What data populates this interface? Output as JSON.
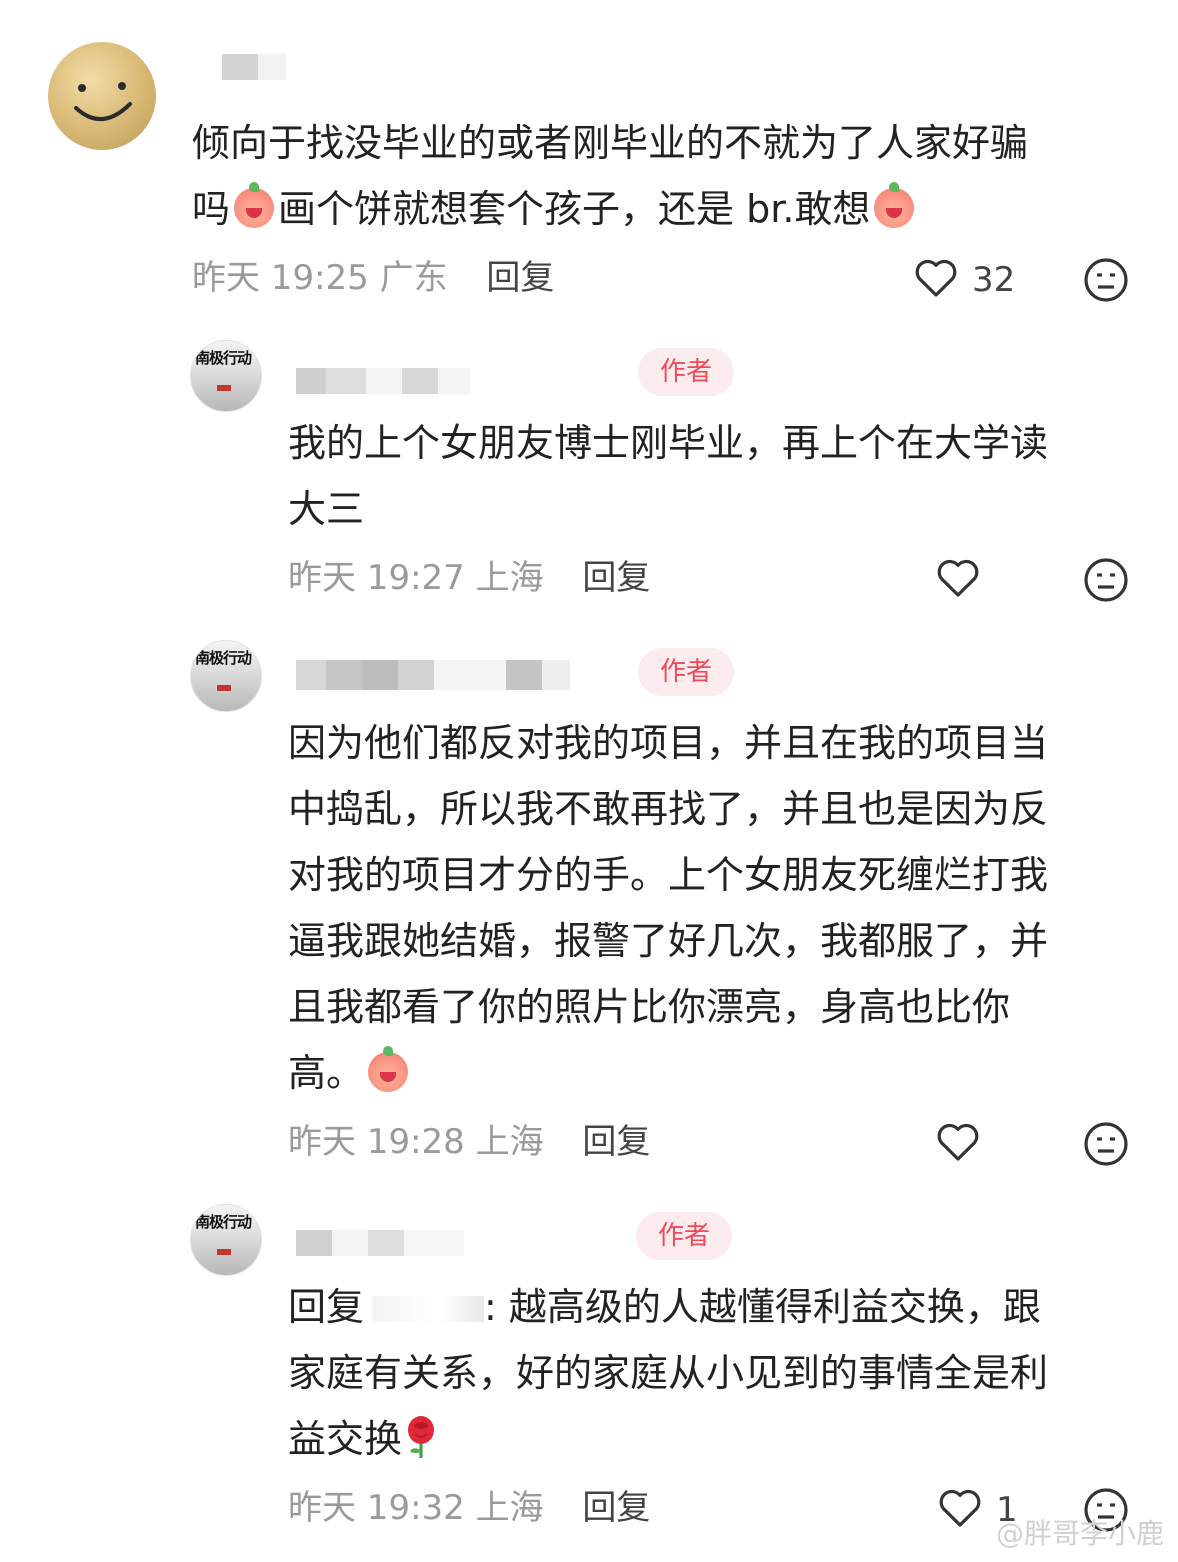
{
  "comments": [
    {
      "text_a": "倾向于找没毕业的或者刚毕业的不就为了人家好骗",
      "text_b1": "吗",
      "text_b2": "画个饼就想套个孩子，还是 br.敢想",
      "time": "昨天 19:25",
      "location": "广东",
      "reply_label": "回复",
      "likes": "32"
    },
    {
      "badge": "作者",
      "line1": "我的上个女朋友博士刚毕业，再上个在大学读",
      "line2": "大三",
      "time": "昨天 19:27",
      "location": "上海",
      "reply_label": "回复"
    },
    {
      "badge": "作者",
      "line1": "因为他们都反对我的项目，并且在我的项目当",
      "line2": "中捣乱，所以我不敢再找了，并且也是因为反",
      "line3": "对我的项目才分的手。上个女朋友死缠烂打我",
      "line4": "逼我跟她结婚，报警了好几次，我都服了，并",
      "line5": "且我都看了你的照片比你漂亮，身高也比你",
      "line6": "高。",
      "time": "昨天 19:28",
      "location": "上海",
      "reply_label": "回复"
    },
    {
      "badge": "作者",
      "reply_prefix": "回复",
      "line1_rest": ": 越高级的人越懂得利益交换，跟",
      "line2": "家庭有关系，好的家庭从小见到的事情全是利",
      "line3": "益交换",
      "time": "昨天 19:32",
      "location": "上海",
      "reply_label": "回复",
      "likes": "1"
    }
  ],
  "avatar_text": "南极行动",
  "watermark": "@胖哥李小鹿",
  "icons": [
    "heart-icon",
    "dislike-face-icon",
    "laughing-emoji-icon",
    "crying-emoji-icon",
    "rose-emoji-icon"
  ],
  "colors": {
    "badge_text": "#f04a5a",
    "badge_bg": "#fdecee",
    "meta": "#9a9a9a"
  }
}
